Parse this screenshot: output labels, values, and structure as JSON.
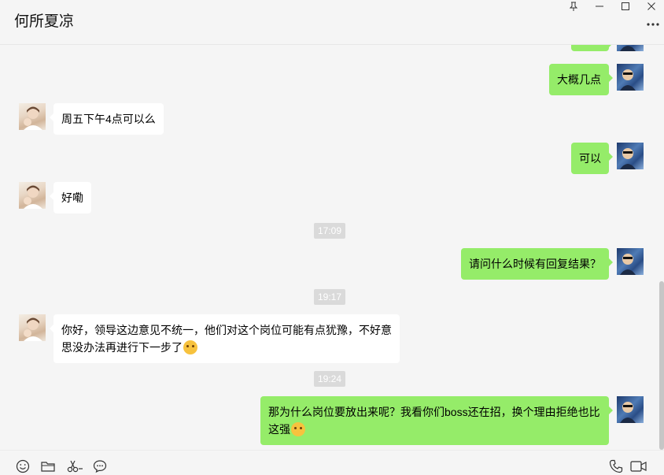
{
  "header": {
    "title": "何所夏凉"
  },
  "messages": {
    "m1": "大概几点",
    "m2": "周五下午4点可以么",
    "m3": "可以",
    "m4": "好嘞",
    "t1": "17:09",
    "m5": "请问什么时候有回复结果？",
    "t2": "19:17",
    "m6_line1": "你好，领导这边意见不统一，他们对这个岗位可能有点犹豫，不好意",
    "m6_line2": "思没办法再进行下一步了",
    "t3": "19:24",
    "m7_line1": "那为什么岗位要放出来呢？我看你们boss还在招，换个理由拒绝也比",
    "m7_line2": "这强"
  },
  "icons": {
    "pin": "pin-icon",
    "minimize": "minimize-icon",
    "maximize": "maximize-icon",
    "close": "close-icon",
    "more": "more-icon",
    "emoji": "emoji-icon",
    "folder": "folder-icon",
    "scissors": "scissors-icon",
    "chat": "chat-bubble-icon",
    "phone": "phone-icon",
    "video": "video-icon"
  },
  "colors": {
    "outgoing_bubble": "#95ec69",
    "incoming_bubble": "#ffffff",
    "timestamp_bg": "#dadada",
    "background": "#f5f5f5"
  }
}
